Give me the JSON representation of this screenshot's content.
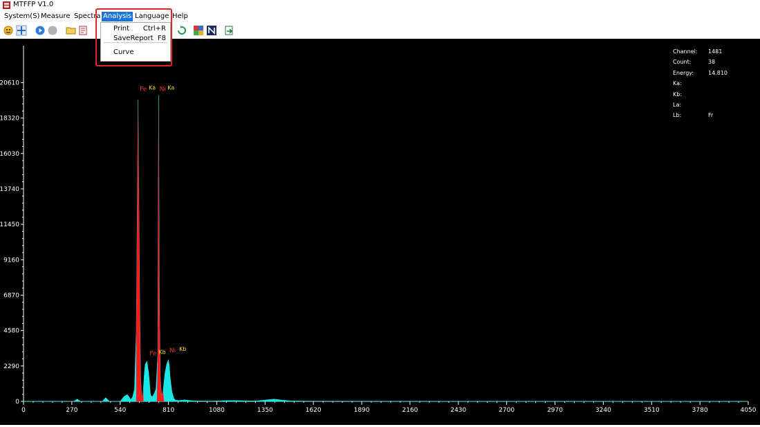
{
  "window": {
    "title": "MTFFP V1.0"
  },
  "menubar": {
    "items": [
      {
        "label": "System(S)"
      },
      {
        "label": "Measure"
      },
      {
        "label": "Spectra"
      },
      {
        "label": "Analysis"
      },
      {
        "label": "Language"
      },
      {
        "label": "Help"
      }
    ],
    "active_index": 3
  },
  "analysis_menu": {
    "items": [
      {
        "label": "Print",
        "shortcut": "Ctrl+R"
      },
      {
        "label": "SaveReport",
        "shortcut": "F8"
      },
      {
        "label": "Curve",
        "shortcut": ""
      }
    ]
  },
  "toolbar": {
    "icons": [
      "smile-icon",
      "move-icon",
      "play-icon",
      "stop-icon",
      "open-folder-icon",
      "print-icon",
      "refresh-icon",
      "color-grid-icon",
      "ni-icon",
      "export-icon"
    ]
  },
  "info_panel": {
    "channel_label": "Channel:",
    "channel_value": "1481",
    "count_label": "Count:",
    "count_value": "38",
    "energy_label": "Energy:",
    "energy_value": "14.810",
    "ka_label": "Ka:",
    "ka_value": "",
    "kb_label": "Kb:",
    "kb_value": "",
    "la_label": "La:",
    "la_value": "",
    "lb_label": "Lb:",
    "lb_value": "Fr"
  },
  "colors": {
    "background": "#000000",
    "spectrum": "#19e6e6",
    "peak_fill": "#ff1a1a",
    "label_red": "#ff3030",
    "label_yellow": "#f0e020",
    "menu_active": "#1e73d6",
    "highlight": "#e0242c"
  },
  "chart_data": {
    "type": "area",
    "x_ticks": [
      0,
      270,
      540,
      810,
      1080,
      1350,
      1620,
      1890,
      2160,
      2430,
      2700,
      2970,
      3240,
      3510,
      3780,
      4050
    ],
    "y_ticks": [
      0,
      2290,
      4580,
      6870,
      9160,
      11450,
      13740,
      16030,
      18320,
      20610
    ],
    "xlim": [
      0,
      4050
    ],
    "ylim": [
      0,
      23000
    ],
    "series": [
      {
        "x": [
          0,
          280,
          300,
          320,
          440,
          460,
          480,
          540,
          560,
          580,
          600,
          610,
          620,
          630,
          640,
          650,
          655,
          660,
          665,
          670,
          675,
          680,
          690,
          700,
          710,
          720,
          730,
          740,
          750,
          755,
          760,
          765,
          770,
          775,
          780,
          790,
          800,
          810,
          815,
          820,
          830,
          840,
          850,
          870,
          900,
          950,
          1000,
          1050,
          1150,
          1300,
          1400,
          1450,
          1500,
          1600,
          2000,
          2500,
          3000,
          3500,
          4050
        ],
        "y": [
          0,
          0,
          150,
          0,
          0,
          250,
          0,
          0,
          300,
          450,
          120,
          300,
          800,
          4500,
          19500,
          6000,
          1500,
          400,
          300,
          900,
          1800,
          2400,
          2600,
          1800,
          400,
          300,
          500,
          800,
          3000,
          19800,
          6000,
          1500,
          600,
          400,
          700,
          1800,
          2400,
          2700,
          2300,
          1500,
          600,
          200,
          80,
          60,
          100,
          40,
          30,
          20,
          60,
          30,
          150,
          80,
          30,
          20,
          15,
          10,
          10,
          8,
          0
        ]
      }
    ],
    "peak_regions": [
      [
        630,
        670
      ],
      [
        745,
        785
      ]
    ],
    "peak_labels": [
      {
        "element": "Fe",
        "line": "Ka",
        "x": 650,
        "y": 19800,
        "line_x": 700
      },
      {
        "element": "Ni",
        "line": "Ka",
        "x": 760,
        "y": 19800,
        "line_x": 805
      },
      {
        "element": "Fe",
        "line": "Kb",
        "x": 705,
        "y": 2700,
        "line_x": 755
      },
      {
        "element": "Ni",
        "line": "Kb",
        "x": 815,
        "y": 2900,
        "line_x": 870
      }
    ]
  }
}
